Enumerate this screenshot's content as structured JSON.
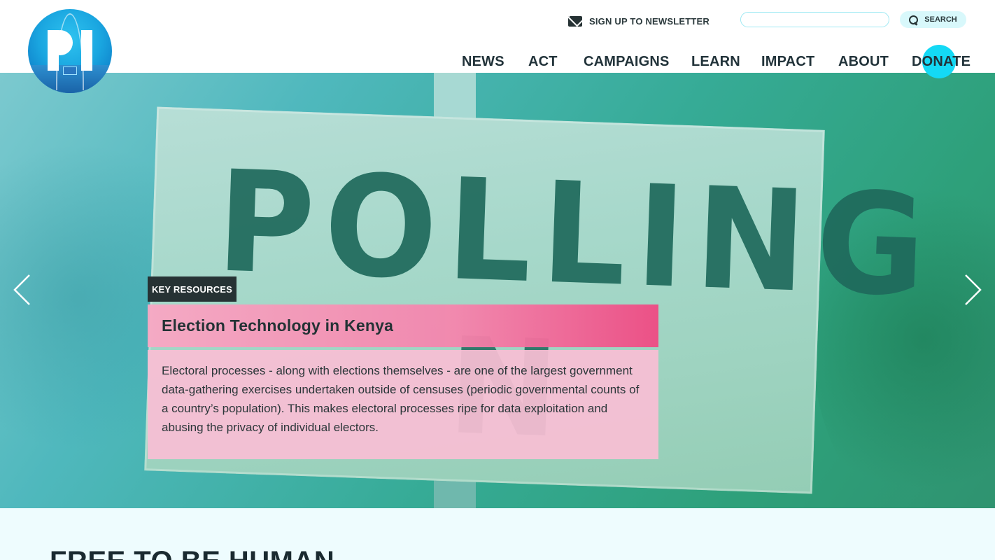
{
  "header": {
    "logo_name": "Privacy International logo",
    "newsletter_label": "SIGN UP TO NEWSLETTER",
    "search": {
      "placeholder": "",
      "value": "",
      "button_label": "SEARCH"
    }
  },
  "nav": {
    "items": [
      "NEWS",
      "ACT",
      "CAMPAIGNS",
      "LEARN",
      "IMPACT",
      "ABOUT",
      "DONATE"
    ]
  },
  "hero": {
    "sign_text_top": "POLLING",
    "sign_text_bottom": "N",
    "tag": "KEY RESOURCES",
    "title": "Election Technology in Kenya",
    "body": "Electoral processes - along with elections themselves - are one of the largest government data-gathering exercises undertaken outside of censuses (periodic governmental counts of a country’s population). This makes electoral processes ripe for data exploitation and abusing the privacy of individual electors.",
    "prev_icon": "chevron-left-icon",
    "next_icon": "chevron-right-icon"
  },
  "bottom": {
    "heading": "FREE TO BE HUMAN"
  },
  "colors": {
    "accent_cyan": "#14d9f5",
    "text_dark": "#22333a",
    "title_pink": "#f585ad",
    "body_pink": "#f9bed4"
  }
}
